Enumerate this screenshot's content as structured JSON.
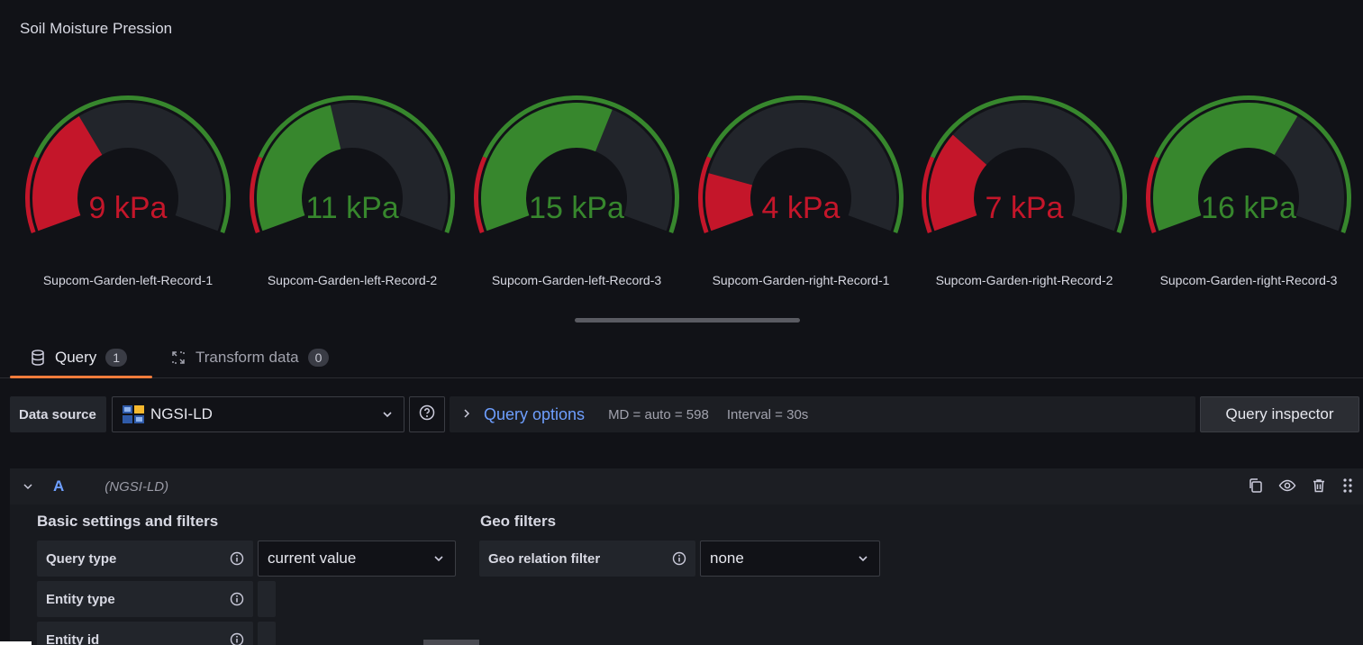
{
  "panel": {
    "title": "Soil Moisture Pression"
  },
  "colors": {
    "green": "#37872d",
    "red": "#c4162a",
    "track": "#22252b",
    "accent": "#6e9fff",
    "tab_underline": "#f47c3c"
  },
  "gauges": [
    {
      "value_text": "9 kPa",
      "value": 9,
      "name": "Supcom-Garden-left-Record-1",
      "status": "red"
    },
    {
      "value_text": "11 kPa",
      "value": 11,
      "name": "Supcom-Garden-left-Record-2",
      "status": "green"
    },
    {
      "value_text": "15 kPa",
      "value": 15,
      "name": "Supcom-Garden-left-Record-3",
      "status": "green"
    },
    {
      "value_text": "4 kPa",
      "value": 4,
      "name": "Supcom-Garden-right-Record-1",
      "status": "red"
    },
    {
      "value_text": "7 kPa",
      "value": 7,
      "name": "Supcom-Garden-right-Record-2",
      "status": "red"
    },
    {
      "value_text": "16 kPa",
      "value": 16,
      "name": "Supcom-Garden-right-Record-3",
      "status": "green"
    }
  ],
  "tabs": [
    {
      "label": "Query",
      "count": "1",
      "icon": "database-icon"
    },
    {
      "label": "Transform data",
      "count": "0",
      "icon": "transform-icon"
    }
  ],
  "toolbar": {
    "datasource_label": "Data source",
    "datasource_value": "NGSI-LD",
    "query_options_label": "Query options",
    "md_text": "MD = auto = 598",
    "interval_text": "Interval = 30s",
    "inspector_label": "Query inspector"
  },
  "query": {
    "ref_id": "A",
    "datasource_name": "(NGSI-LD)",
    "basic_title": "Basic settings and filters",
    "geo_title": "Geo filters",
    "query_type_label": "Query type",
    "query_type_value": "current value",
    "entity_type_label": "Entity type",
    "entity_id_label": "Entity id",
    "geo_relation_label": "Geo relation filter",
    "geo_relation_value": "none"
  }
}
